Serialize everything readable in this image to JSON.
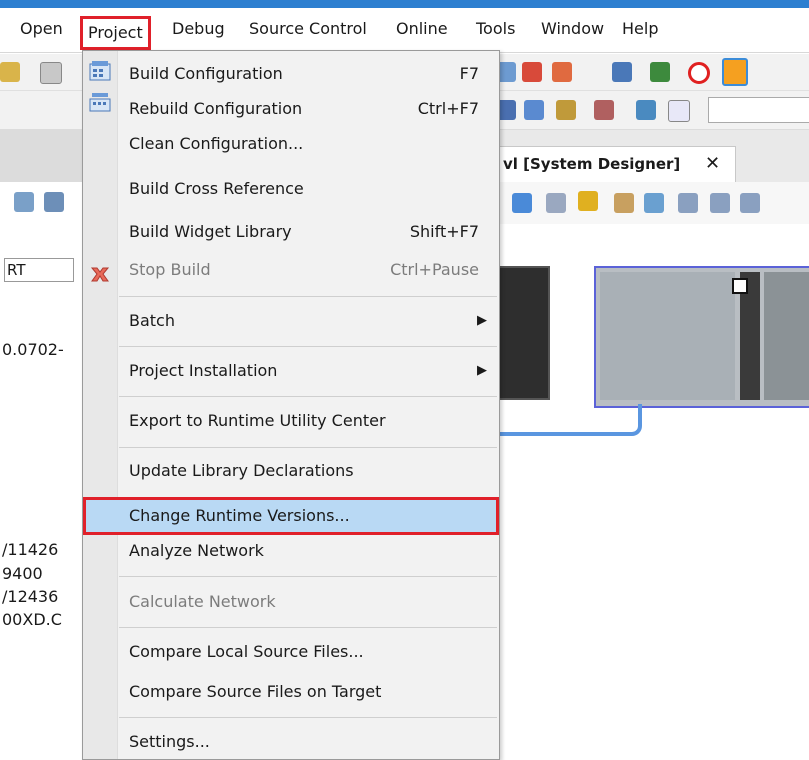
{
  "menubar": {
    "items": [
      {
        "label": "Open"
      },
      {
        "label": "Project"
      },
      {
        "label": "Debug"
      },
      {
        "label": "Source Control"
      },
      {
        "label": "Online"
      },
      {
        "label": "Tools"
      },
      {
        "label": "Window"
      },
      {
        "label": "Help"
      }
    ],
    "active_index": 1
  },
  "document_tab": {
    "title": "vl [System Designer]",
    "close": "✕"
  },
  "left_panel": {
    "field_value": "RT",
    "texts": [
      "0.0702-",
      "/11426",
      "9400",
      "/12436",
      "00XD.C"
    ]
  },
  "project_menu": {
    "items": [
      {
        "label": "Build Configuration",
        "shortcut": "F7",
        "icon": "build-config-icon",
        "disabled": false
      },
      {
        "label": "Rebuild Configuration",
        "shortcut": "Ctrl+F7",
        "icon": "rebuild-config-icon",
        "disabled": false
      },
      {
        "label": "Clean Configuration...",
        "shortcut": "",
        "disabled": false
      },
      {
        "label": "Build Cross Reference",
        "shortcut": "",
        "disabled": false
      },
      {
        "label": "Build Widget Library",
        "shortcut": "Shift+F7",
        "disabled": false
      },
      {
        "label": "Stop Build",
        "shortcut": "Ctrl+Pause",
        "icon": "stop-build-icon",
        "disabled": true
      },
      {
        "label": "Batch",
        "submenu": true,
        "disabled": false
      },
      {
        "label": "Project Installation",
        "submenu": true,
        "disabled": false
      },
      {
        "label": "Export to Runtime Utility Center",
        "disabled": false
      },
      {
        "label": "Update Library Declarations",
        "disabled": false
      },
      {
        "label": "Change Runtime Versions...",
        "disabled": false,
        "highlighted": true
      },
      {
        "label": "Analyze Network",
        "disabled": false
      },
      {
        "label": "Calculate Network",
        "disabled": true
      },
      {
        "label": "Compare Local Source Files...",
        "disabled": false
      },
      {
        "label": "Compare Source Files on Target",
        "disabled": false
      },
      {
        "label": "Settings...",
        "disabled": false
      }
    ],
    "submenu_arrow": "▶"
  },
  "colors": {
    "highlight_outline": "#e0202a",
    "hover_background": "#b9d9f4",
    "title_strip": "#2d7fd0",
    "connector": "#5a96e0"
  }
}
